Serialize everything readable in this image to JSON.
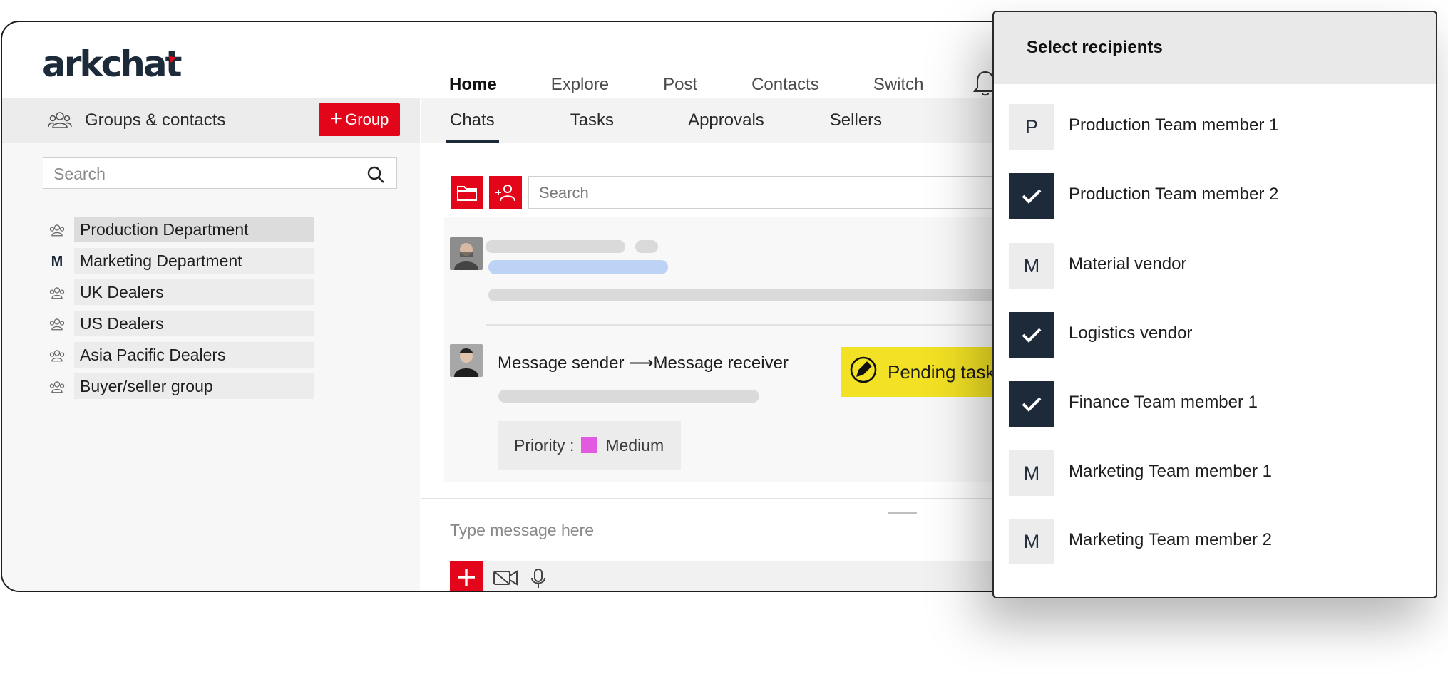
{
  "app": {
    "logo_text": "arkchat",
    "nav": [
      "Home",
      "Explore",
      "Post",
      "Contacts",
      "Switch"
    ],
    "nav_active": "Home"
  },
  "groups": {
    "title": "Groups & contacts",
    "add_button_label": "Group",
    "search_placeholder": "Search",
    "items": [
      {
        "label": "Production Department",
        "icon": "group-icon"
      },
      {
        "label": "Marketing Department",
        "icon": "letter-avatar",
        "letter": "M"
      },
      {
        "label": "UK Dealers",
        "icon": "group-icon"
      },
      {
        "label": "US Dealers",
        "icon": "group-icon"
      },
      {
        "label": "Asia Pacific Dealers",
        "icon": "group-icon"
      },
      {
        "label": "Buyer/seller group",
        "icon": "group-icon"
      }
    ],
    "selected": "Production Department"
  },
  "chat": {
    "tabs": [
      "Chats",
      "Tasks",
      "Approvals",
      "Sellers"
    ],
    "active_tab": "Chats",
    "search_placeholder": "Search",
    "message": {
      "sender": "Message sender",
      "arrow": "⟶",
      "receiver": "Message receiver",
      "task_badge": "Pending task",
      "priority_label": "Priority :",
      "priority_value": "Medium",
      "priority_color": "#e35ae0"
    },
    "compose_placeholder": "Type message here"
  },
  "recipients": {
    "title": "Select recipients",
    "items": [
      {
        "name": "Production Team member 1",
        "letter": "P",
        "checked": false
      },
      {
        "name": "Production Team member 2",
        "letter": "",
        "checked": true
      },
      {
        "name": "Material vendor",
        "letter": "M",
        "checked": false
      },
      {
        "name": "Logistics vendor",
        "letter": "",
        "checked": true
      },
      {
        "name": "Finance Team member 1",
        "letter": "",
        "checked": true
      },
      {
        "name": "Marketing Team member 1",
        "letter": "M",
        "checked": false
      },
      {
        "name": "Marketing Team member 2",
        "letter": "M",
        "checked": false
      }
    ]
  },
  "colors": {
    "accent": "#e3061b",
    "navy": "#1c2a3a",
    "task_yellow": "#f2e124"
  }
}
